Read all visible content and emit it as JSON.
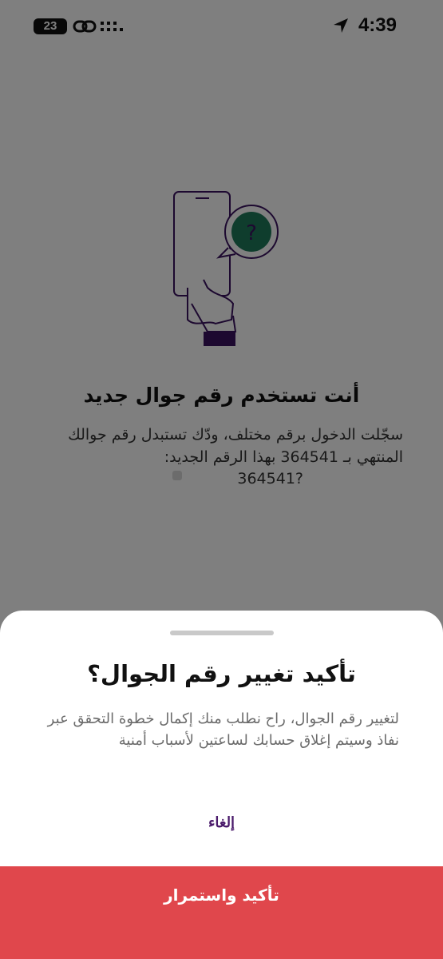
{
  "status_bar": {
    "time": "4:39",
    "battery": "23",
    "icons": [
      "location-arrow-icon",
      "link-icon",
      "signal-icon"
    ]
  },
  "page": {
    "illustration": "phone-question-icon",
    "headline": "أنت تستخدم رقم جوال جديد",
    "description": "سجّلت الدخول برقم مختلف، ودّك تستبدل رقم جوالك المنتهي بـ 364541 بهذا الرقم الجديد:",
    "new_number": "364541?"
  },
  "sheet": {
    "title": "تأكيد تغيير رقم الجوال؟",
    "description": "لتغيير رقم الجوال، راح نطلب منك إكمال خطوة التحقق عبر نفاذ وسيتم إغلاق حسابك لساعتين لأسباب أمنية",
    "cancel_label": "إلغاء",
    "confirm_label": "تأكيد واستمرار"
  },
  "colors": {
    "confirm_button": "#e0474c",
    "cancel_text": "#4a1a6b",
    "illustration_accent": "#1f7a5a",
    "illustration_stroke": "#3b1260"
  }
}
